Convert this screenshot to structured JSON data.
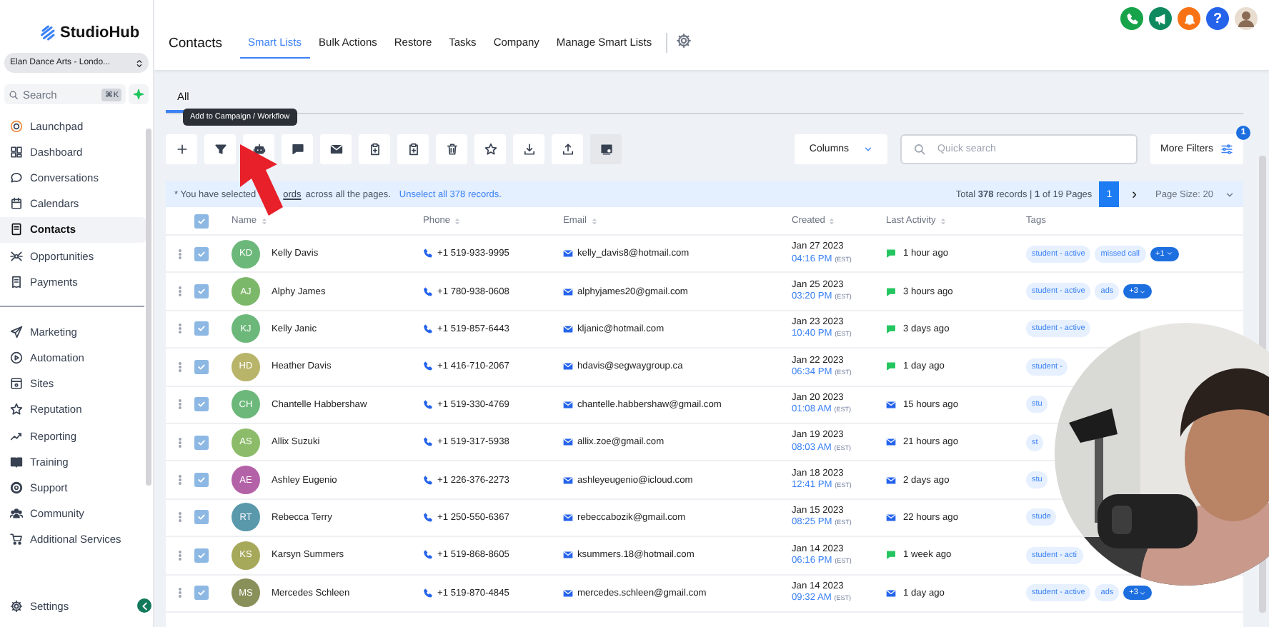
{
  "sidebar": {
    "logo": "StudioHub",
    "account": "Elan Dance Arts - Londo...",
    "search": {
      "placeholder": "Search",
      "shortcut": "⌘K"
    },
    "sections": [
      [
        {
          "label": "Launchpad",
          "selected": false
        },
        {
          "label": "Dashboard",
          "selected": false
        },
        {
          "label": "Conversations",
          "selected": false
        },
        {
          "label": "Calendars",
          "selected": false
        },
        {
          "label": "Contacts",
          "selected": true
        },
        {
          "label": "Opportunities",
          "selected": false
        },
        {
          "label": "Payments",
          "selected": false
        }
      ],
      [
        {
          "label": "Marketing",
          "selected": false
        },
        {
          "label": "Automation",
          "selected": false
        },
        {
          "label": "Sites",
          "selected": false
        },
        {
          "label": "Reputation",
          "selected": false
        },
        {
          "label": "Reporting",
          "selected": false
        },
        {
          "label": "Training",
          "selected": false
        },
        {
          "label": "Support",
          "selected": false
        },
        {
          "label": "Community",
          "selected": false
        },
        {
          "label": "Additional Services",
          "selected": false
        }
      ]
    ],
    "settings": "Settings"
  },
  "header": {
    "title": "Contacts",
    "tabs": [
      {
        "label": "Smart Lists",
        "selected": true
      },
      {
        "label": "Bulk Actions",
        "selected": false
      },
      {
        "label": "Restore",
        "selected": false
      },
      {
        "label": "Tasks",
        "selected": false
      },
      {
        "label": "Company",
        "selected": false
      },
      {
        "label": "Manage Smart Lists",
        "selected": false
      }
    ],
    "help": "?"
  },
  "subtabs": [
    {
      "label": "All",
      "selected": true
    }
  ],
  "tooltip": "Add to Campaign / Workflow",
  "toolbar": {
    "buttons": [
      {
        "selected": false
      },
      {
        "selected": false
      },
      {
        "selected": false
      },
      {
        "selected": false
      },
      {
        "selected": false
      },
      {
        "selected": false
      },
      {
        "selected": false
      },
      {
        "selected": false
      },
      {
        "selected": false
      },
      {
        "selected": false
      },
      {
        "selected": false
      },
      {
        "selected": true
      }
    ],
    "columns": "Columns",
    "quick_search": {
      "placeholder": "Quick search"
    },
    "more_filters": {
      "label": "More Filters",
      "badge": "1"
    }
  },
  "notice": {
    "prefix": "* You have selected",
    "link": "ords",
    "suffix": "across all the pages.",
    "action": "Unselect all 378 records."
  },
  "pagination": {
    "summary": "Total **378** records | **1** of 19 Pages",
    "pages": [
      {
        "label": "1",
        "selected": true
      }
    ],
    "next": "›",
    "page_size": "Page Size: 20"
  },
  "table": {
    "all_checked": true,
    "columns": [
      {
        "label": "Name",
        "sortable": true
      },
      {
        "label": "Phone",
        "sortable": true
      },
      {
        "label": "Email",
        "sortable": true
      },
      {
        "label": "Created",
        "sortable": true
      },
      {
        "label": "Last Activity",
        "sortable": true
      },
      {
        "label": "Tags",
        "sortable": false
      }
    ],
    "rows": [
      {
        "checked": true,
        "initials": "KD",
        "color": "#6cb87a",
        "name": "Kelly Davis",
        "phone": "+1 519-933-9995",
        "email": "kelly_davis8@hotmail.com",
        "date": "Jan 27 2023",
        "time": "04:16 PM",
        "tz": "(EST)",
        "activity": {
          "kind": "sms",
          "text": "1 hour ago"
        },
        "tags": [
          "student - active",
          "missed call"
        ],
        "more": "+1"
      },
      {
        "checked": true,
        "initials": "AJ",
        "color": "#7cb86a",
        "name": "Alphy James",
        "phone": "+1 780-938-0608",
        "email": "alphyjames20@gmail.com",
        "date": "Jan 25 2023",
        "time": "03:20 PM",
        "tz": "(EST)",
        "activity": {
          "kind": "sms",
          "text": "3 hours ago"
        },
        "tags": [
          "student - active",
          "ads"
        ],
        "more": "+3"
      },
      {
        "checked": true,
        "initials": "KJ",
        "color": "#6cb87a",
        "name": "Kelly Janic",
        "phone": "+1 519-857-6443",
        "email": "kljanic@hotmail.com",
        "date": "Jan 23 2023",
        "time": "10:40 PM",
        "tz": "(EST)",
        "activity": {
          "kind": "sms",
          "text": "3 days ago"
        },
        "tags": [
          "student - active"
        ]
      },
      {
        "checked": true,
        "initials": "HD",
        "color": "#b8b46a",
        "name": "Heather Davis",
        "phone": "+1 416-710-2067",
        "email": "hdavis@segwaygroup.ca",
        "date": "Jan 22 2023",
        "time": "06:34 PM",
        "tz": "(EST)",
        "activity": {
          "kind": "sms",
          "text": "1 day ago"
        },
        "tags": [
          "student -"
        ]
      },
      {
        "checked": true,
        "initials": "CH",
        "color": "#6cb87a",
        "name": "Chantelle Habbershaw",
        "phone": "+1 519-330-4769",
        "email": "chantelle.habbershaw@gmail.com",
        "date": "Jan 20 2023",
        "time": "01:08 AM",
        "tz": "(EST)",
        "activity": {
          "kind": "email",
          "text": "15 hours ago"
        },
        "tags": [
          "stu"
        ]
      },
      {
        "checked": true,
        "initials": "AS",
        "color": "#8cbc6a",
        "name": "Allix Suzuki",
        "phone": "+1 519-317-5938",
        "email": "allix.zoe@gmail.com",
        "date": "Jan 19 2023",
        "time": "08:03 AM",
        "tz": "(EST)",
        "activity": {
          "kind": "email",
          "text": "21 hours ago"
        },
        "tags": [
          "st"
        ]
      },
      {
        "checked": true,
        "initials": "AE",
        "color": "#b462a8",
        "name": "Ashley Eugenio",
        "phone": "+1 226-376-2273",
        "email": "ashleyeugenio@icloud.com",
        "date": "Jan 18 2023",
        "time": "12:41 PM",
        "tz": "(EST)",
        "activity": {
          "kind": "email",
          "text": "2 days ago"
        },
        "tags": [
          "stu"
        ]
      },
      {
        "checked": true,
        "initials": "RT",
        "color": "#5a98ac",
        "name": "Rebecca Terry",
        "phone": "+1 250-550-6367",
        "email": "rebeccabozik@gmail.com",
        "date": "Jan 15 2023",
        "time": "08:25 PM",
        "tz": "(EST)",
        "activity": {
          "kind": "email",
          "text": "22 hours ago"
        },
        "tags": [
          "stude"
        ]
      },
      {
        "checked": true,
        "initials": "KS",
        "color": "#a6a85a",
        "name": "Karsyn Summers",
        "phone": "+1 519-868-8605",
        "email": "ksummers.18@hotmail.com",
        "date": "Jan 14 2023",
        "time": "06:16 PM",
        "tz": "(EST)",
        "activity": {
          "kind": "sms",
          "text": "1 week ago"
        },
        "tags": [
          "student - acti"
        ]
      },
      {
        "checked": true,
        "initials": "MS",
        "color": "#8a905a",
        "name": "Mercedes Schleen",
        "phone": "+1 519-870-4845",
        "email": "mercedes.schleen@gmail.com",
        "date": "Jan 14 2023",
        "time": "09:32 AM",
        "tz": "(EST)",
        "activity": {
          "kind": "email",
          "text": "1 day ago"
        },
        "tags": [
          "student - active",
          "ads"
        ],
        "more": "+3"
      }
    ]
  }
}
